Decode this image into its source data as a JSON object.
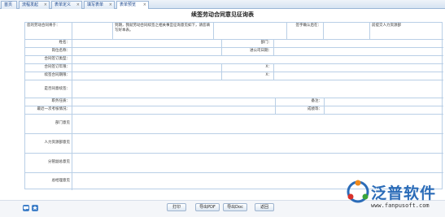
{
  "tabs": [
    {
      "label": "首页"
    },
    {
      "label": "流程发起",
      "close": "×"
    },
    {
      "label": "表单定义",
      "close": "×"
    },
    {
      "label": "填写表单",
      "close": "×"
    },
    {
      "label": "表单预览",
      "close": "×"
    }
  ],
  "form": {
    "title": "续签劳动合同意见征询表",
    "intro_label": "您的劳动合同将于：",
    "intro_text": "到期，我就劳动合同续签之相关事宜征询意见如下，请您填写好本表。",
    "signature_label": "签字确认后在：",
    "submit_to": "前提交人力资源部",
    "fields": {
      "name": "姓名：",
      "department": "部门：",
      "position": "岗位名称：",
      "entry_date": "进公司日期：",
      "contract_type": "合同签订类型：",
      "contract_term": "合同签订年限：",
      "renew_term": "续签合同期限：",
      "x1": "X：",
      "x2": "X：",
      "agree": "是否同意续签：",
      "duty": "职务任质：",
      "note": "备注：",
      "last_review": "最近一次考核情况：",
      "score": "成绩等：",
      "dept_opinion": "部门意见",
      "hr_opinion": "人力资源部意见",
      "vp_opinion": "分管副总意见",
      "gm_opinion": "总经理意见"
    }
  },
  "buttons": {
    "print": "打印",
    "export_pdf": "导出PDF",
    "export_doc": "导出Doc",
    "back": "返回"
  },
  "logo": {
    "name": "泛普软件",
    "url": "www.fanpusoft.com"
  },
  "colors": {
    "border": "#b9cfe6",
    "tab_text": "#15428b",
    "logo_blue": "#2b6cb8",
    "logo_orange": "#f08a1c",
    "logo_red": "#d9312b",
    "logo_green": "#3aa53a"
  }
}
